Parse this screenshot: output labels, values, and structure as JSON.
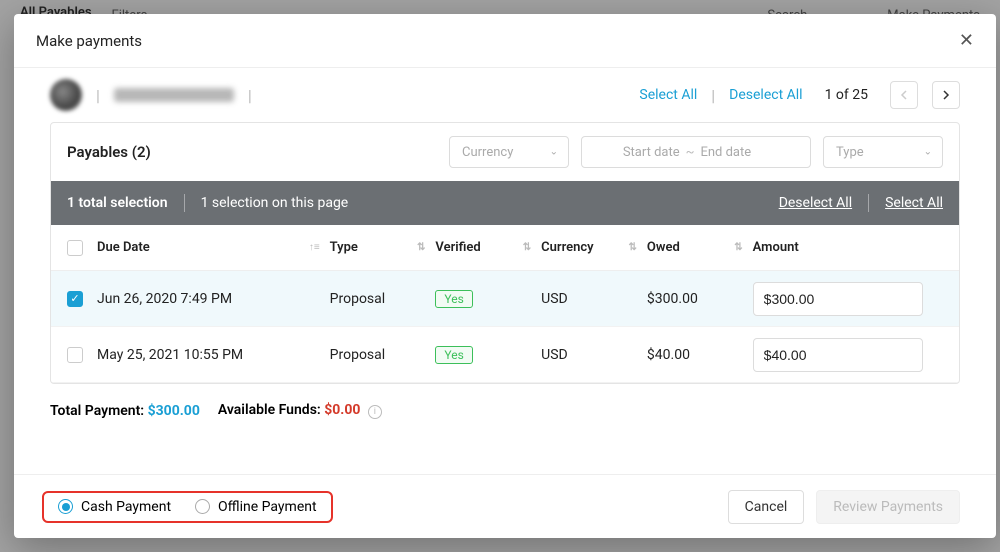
{
  "bg": {
    "tab": "All Payables",
    "filters": "Filters",
    "search_placeholder": "Search",
    "make_payments": "Make Payments"
  },
  "modal": {
    "title": "Make payments"
  },
  "subheader": {
    "select_all": "Select All",
    "deselect_all": "Deselect All",
    "pager": "1 of 25"
  },
  "panel": {
    "title": "Payables (2)",
    "filters": {
      "currency": "Currency",
      "start_date": "Start date",
      "end_date": "End date",
      "tilde": "~",
      "type": "Type"
    }
  },
  "selection_bar": {
    "total": "1 total selection",
    "on_page": "1 selection on this page",
    "deselect_all": "Deselect All",
    "select_all": "Select All"
  },
  "columns": {
    "due": "Due Date",
    "type": "Type",
    "verified": "Verified",
    "currency": "Currency",
    "owed": "Owed",
    "amount": "Amount"
  },
  "rows": [
    {
      "checked": true,
      "due": "Jun 26, 2020 7:49 PM",
      "type": "Proposal",
      "verified": "Yes",
      "currency": "USD",
      "owed": "$300.00",
      "amount": "$300.00"
    },
    {
      "checked": false,
      "due": "May 25, 2021 10:55 PM",
      "type": "Proposal",
      "verified": "Yes",
      "currency": "USD",
      "owed": "$40.00",
      "amount": "$40.00"
    }
  ],
  "totals": {
    "total_payment_label": "Total Payment:",
    "total_payment": "$300.00",
    "available_label": "Available Funds:",
    "available": "$0.00"
  },
  "footer": {
    "cash": "Cash Payment",
    "offline": "Offline Payment",
    "cancel": "Cancel",
    "review": "Review Payments"
  }
}
